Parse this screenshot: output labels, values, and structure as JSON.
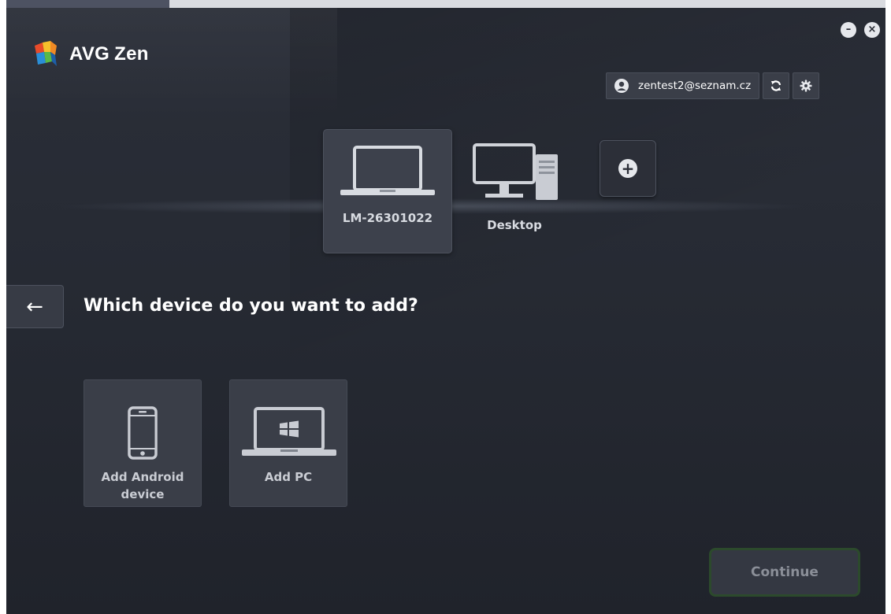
{
  "app": {
    "brand": "AVG",
    "product": "Zen"
  },
  "window_controls": {
    "minimize": "–",
    "close": "×"
  },
  "account": {
    "email": "zentest2@seznam.cz",
    "user_icon": "user-icon",
    "refresh_icon": "refresh-icon",
    "settings_icon": "gear-icon"
  },
  "devices": [
    {
      "label": "LM-26301022",
      "icon": "laptop-icon",
      "selected": true
    },
    {
      "label": "Desktop",
      "icon": "desktop-computer-icon",
      "selected": false
    }
  ],
  "add_device": {
    "icon": "plus-icon",
    "symbol": "+"
  },
  "back": {
    "symbol": "←",
    "icon": "back-arrow-icon"
  },
  "heading": "Which device do you want to add?",
  "options": [
    {
      "label": "Add Android\ndevice",
      "icon": "smartphone-icon"
    },
    {
      "label": "Add PC",
      "icon": "windows-laptop-icon"
    }
  ],
  "continue_label": "Continue",
  "colors": {
    "background": "#262a33",
    "card": "#3a3e48",
    "selected_card": "#3d414c",
    "continue_border": "#2c4a2c",
    "text": "#ffffff"
  }
}
